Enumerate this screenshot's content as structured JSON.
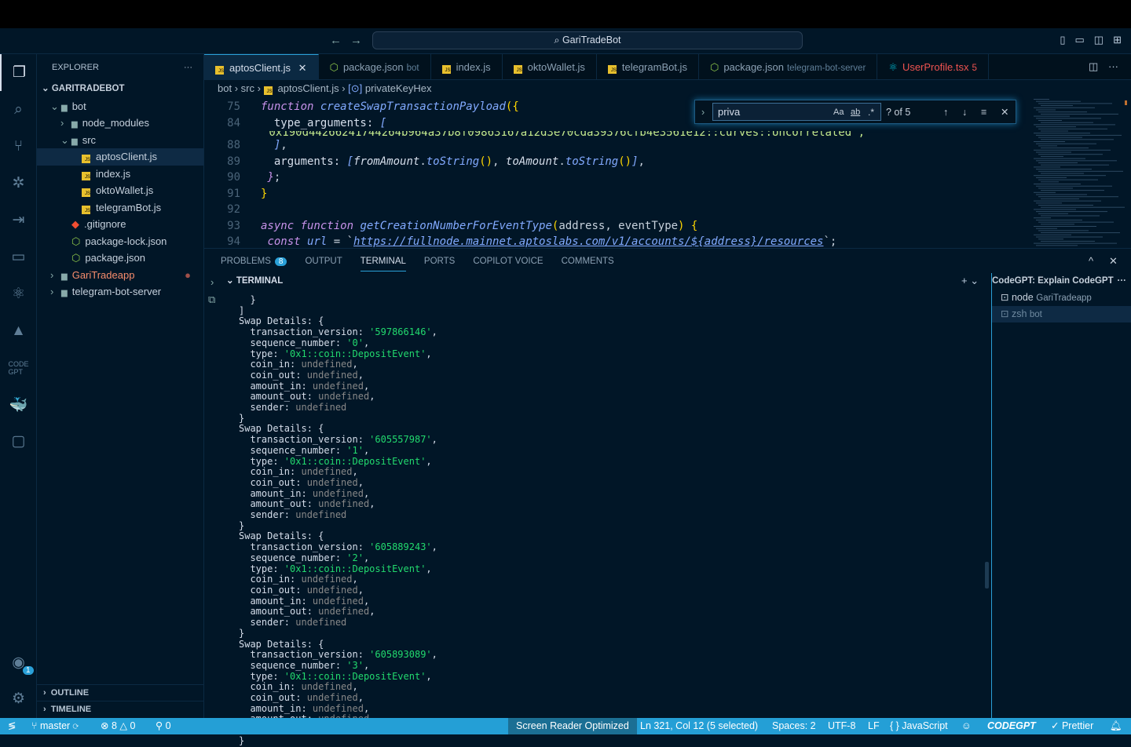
{
  "title": "GariTradeBot",
  "explorer": {
    "header": "EXPLORER",
    "root": "GARITRADEBOT",
    "tree": [
      {
        "label": "bot",
        "indent": 1,
        "type": "folder-open",
        "color": "#c5d0dc"
      },
      {
        "label": "node_modules",
        "indent": 2,
        "type": "folder"
      },
      {
        "label": "src",
        "indent": 2,
        "type": "folder-open"
      },
      {
        "label": "aptosClient.js",
        "indent": 3,
        "type": "js",
        "selected": true
      },
      {
        "label": "index.js",
        "indent": 3,
        "type": "js"
      },
      {
        "label": "oktoWallet.js",
        "indent": 3,
        "type": "js"
      },
      {
        "label": "telegramBot.js",
        "indent": 3,
        "type": "js"
      },
      {
        "label": ".gitignore",
        "indent": 2,
        "type": "git"
      },
      {
        "label": "package-lock.json",
        "indent": 2,
        "type": "json"
      },
      {
        "label": "package.json",
        "indent": 2,
        "type": "json"
      },
      {
        "label": "GariTradeapp",
        "indent": 1,
        "type": "folder",
        "color": "#f78c6c"
      },
      {
        "label": "telegram-bot-server",
        "indent": 1,
        "type": "folder"
      }
    ],
    "outline": "OUTLINE",
    "timeline": "TIMELINE"
  },
  "tabs": [
    {
      "label": "aptosClient.js",
      "desc": "",
      "active": true,
      "icon": "js"
    },
    {
      "label": "package.json",
      "desc": "bot",
      "icon": "json"
    },
    {
      "label": "index.js",
      "desc": "",
      "icon": "js"
    },
    {
      "label": "oktoWallet.js",
      "desc": "",
      "icon": "js"
    },
    {
      "label": "telegramBot.js",
      "desc": "",
      "icon": "js"
    },
    {
      "label": "package.json",
      "desc": "telegram-bot-server",
      "icon": "json"
    },
    {
      "label": "UserProfile.tsx",
      "desc": "5",
      "icon": "react",
      "error": true
    }
  ],
  "breadcrumb": [
    "bot",
    "src",
    "aptosClient.js",
    "privateKeyHex"
  ],
  "find": {
    "value": "priva",
    "case": "Aa",
    "word": "ab",
    "regex": ".*",
    "result": "? of 5"
  },
  "code": [
    {
      "n": "75",
      "html": "<span class='kw'>function</span> <span class='fn'>createSwapTransactionPayload</span><span class='yb'>({</span>"
    },
    {
      "n": "84",
      "html": "  <span class='pr'>type_arguments: </span><span class='fn'>[</span>"
    },
    {
      "n": "88",
      "html": "  <span class='fn'>]</span>,"
    },
    {
      "n": "89",
      "html": "  <span class='pr'>arguments: </span><span class='fn'>[</span><span class='pr' style='font-style:italic'>fromAmount</span>.<span class='fn'>toString</span><span class='yb'>()</span>, <span class='pr' style='font-style:italic'>toAmount</span>.<span class='fn'>toString</span><span class='yb'>()</span><span class='fn'>]</span>,"
    },
    {
      "n": "90",
      "html": " <span class='kw'>}</span>;"
    },
    {
      "n": "91",
      "html": "<span class='yb'>}</span>"
    },
    {
      "n": "92",
      "html": ""
    },
    {
      "n": "93",
      "html": "<span class='kw'>async function</span> <span class='fn'>getCreationNumberForEventType</span><span class='yb'>(</span>address, eventType<span class='yb'>)</span> <span class='yb'>{</span>"
    },
    {
      "n": "94",
      "html": " <span class='kw'>const</span> <span class='fn'>url</span> = `<span class='url'>https://fullnode.mainnet.aptoslabs.com/v1/accounts/${address}/resources</span>`;"
    }
  ],
  "panel": {
    "tabs": [
      "PROBLEMS",
      "OUTPUT",
      "TERMINAL",
      "PORTS",
      "COPILOT VOICE",
      "COMMENTS"
    ],
    "problems_count": "8",
    "active": "TERMINAL",
    "terminal_header": "TERMINAL",
    "right_title": "CodeGPT: Explain CodeGPT",
    "terminals": [
      {
        "name": "node",
        "desc": "GariTradeapp"
      },
      {
        "name": "zsh",
        "desc": "bot"
      }
    ]
  },
  "terminal_pre": [
    "  }",
    "]"
  ],
  "swaps": [
    {
      "transaction_version": "'597866146'",
      "sequence_number": "'0'",
      "type": "'0x1::coin::DepositEvent'"
    },
    {
      "transaction_version": "'605557987'",
      "sequence_number": "'1'",
      "type": "'0x1::coin::DepositEvent'"
    },
    {
      "transaction_version": "'605889243'",
      "sequence_number": "'2'",
      "type": "'0x1::coin::DepositEvent'"
    },
    {
      "transaction_version": "'605893089'",
      "sequence_number": "'3'",
      "type": "'0x1::coin::DepositEvent'"
    }
  ],
  "status": {
    "branch": "master",
    "errors": "8",
    "warnings": "0",
    "ports": "0",
    "screen_reader": "Screen Reader Optimized",
    "position": "Ln 321, Col 12 (5 selected)",
    "spaces": "Spaces: 2",
    "encoding": "UTF-8",
    "eol": "LF",
    "language": "JavaScript",
    "codegpt": "CODEGPT",
    "prettier": "Prettier",
    "account_badge": "1"
  },
  "colors": {
    "accent": "#249fd6",
    "background": "#011627"
  }
}
